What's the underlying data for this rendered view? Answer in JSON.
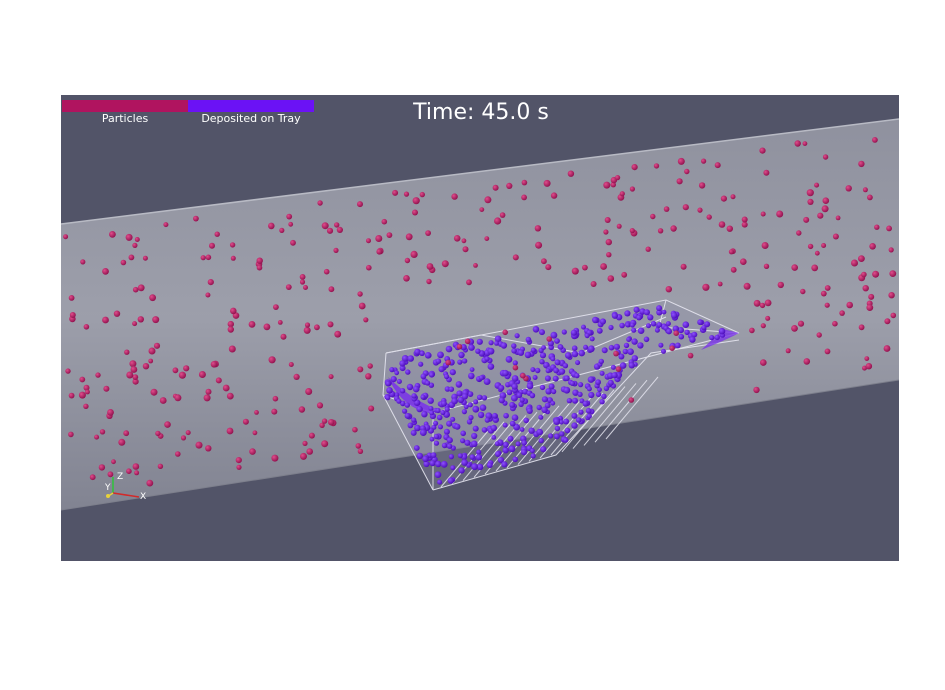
{
  "legend": {
    "items": [
      {
        "label": "Particles",
        "color": "#b0145f"
      },
      {
        "label": "Deposited on Tray",
        "color": "#6b12f5"
      }
    ]
  },
  "time_label": "Time: 45.0 s",
  "axes": {
    "x": "X",
    "y": "Y",
    "z": "Z"
  },
  "colors": {
    "background": "#525468",
    "pipe": "#9a9ca8",
    "particle": "#b0145f",
    "deposited": "#6b12f5",
    "tray_lines": "#e6e6f0"
  }
}
